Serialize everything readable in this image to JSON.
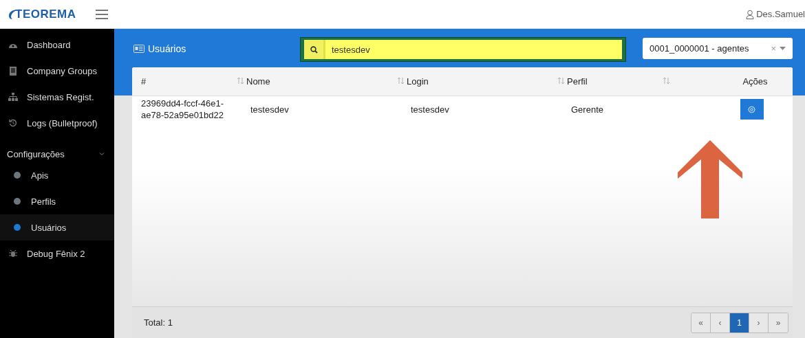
{
  "header": {
    "logo": "TEOREMA",
    "user": "Des.Samuel"
  },
  "sidebar": {
    "items": [
      {
        "label": "Dashboard",
        "selected": false
      },
      {
        "label": "Company Groups",
        "selected": false
      },
      {
        "label": "Sistemas Regist.",
        "selected": false
      },
      {
        "label": "Logs (Bulletproof)",
        "selected": false
      },
      {
        "label": "Configurações",
        "expanded": true,
        "children": [
          {
            "label": "Apis",
            "selected": false
          },
          {
            "label": "Perfils",
            "selected": false
          },
          {
            "label": "Usuários",
            "selected": true
          }
        ]
      },
      {
        "label": "Debug Fênix 2",
        "selected": false
      }
    ]
  },
  "page": {
    "title": "Usuários",
    "search": {
      "value": "testesdev"
    },
    "company_select": {
      "value": "0001_0000001 - agentes",
      "clear": "×"
    }
  },
  "table": {
    "columns": [
      {
        "label": "#",
        "sortable": false
      },
      {
        "label": "Nome",
        "sortable": true
      },
      {
        "label": "Login",
        "sortable": true
      },
      {
        "label": "Perfil",
        "sortable": true
      },
      {
        "sortable": true
      },
      {
        "label": "Ações",
        "sortable": false
      }
    ],
    "rows": [
      {
        "id": "23969dd4-fccf-46e1-ae78-52a95e01bd22",
        "nome": "testesdev",
        "login": "testesdev",
        "perfil": "Gerente"
      }
    ]
  },
  "footer": {
    "total": "Total: 1",
    "pagination": [
      {
        "label": "«",
        "selected": false
      },
      {
        "label": "‹",
        "selected": false
      },
      {
        "label": "1",
        "selected": true
      },
      {
        "label": "›",
        "selected": false
      },
      {
        "label": "»",
        "selected": false
      }
    ]
  }
}
